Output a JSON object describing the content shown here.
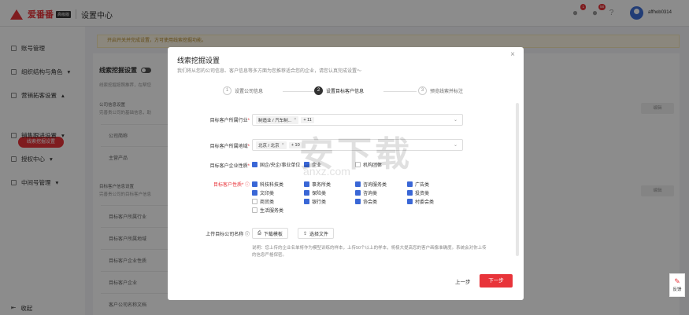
{
  "header": {
    "logo_text": "爱番番",
    "logo_badge": "高级版",
    "title": "设置中心",
    "badges": [
      "1",
      "58"
    ],
    "username": "affhob0314"
  },
  "sidebar": {
    "items": [
      {
        "label": "账号管理"
      },
      {
        "label": "组织结构与角色"
      },
      {
        "label": "营销拓客设置"
      },
      {
        "label": "销售跟进设置"
      },
      {
        "label": "授权中心"
      },
      {
        "label": "中间号管理"
      }
    ],
    "active_sub": "线索挖掘设置",
    "collapse_label": "收起"
  },
  "notice": "开启开关并完成设置，方可使用线索挖掘功能。",
  "content": {
    "title": "线索挖掘设置",
    "desc": "线索挖掘按照推荐，在帮您",
    "section1_title": "公司信息设置",
    "section1_desc": "完善贵公司的基础信息，助",
    "rows1": [
      "公司简称",
      "主营产品"
    ],
    "section2_title": "目标客户信息设置",
    "section2_desc": "完善贵公司的目标客户信息",
    "rows2": [
      "目标客户所属行业",
      "目标客户所属地域",
      "目标客户企业性质",
      "目标客户企业",
      "客户公司名称文档"
    ],
    "edit_label": "编辑"
  },
  "modal": {
    "title": "线索挖掘设置",
    "subtitle": "我们将从您的公司信息、客户信息等多方面为您推荐适合您的企业，请您认真完成设置～",
    "steps": [
      {
        "num": "1",
        "label": "设置公司信息"
      },
      {
        "num": "2",
        "label": "设置目标客户信息"
      },
      {
        "num": "3",
        "label": "预览线索并标注"
      }
    ],
    "industry_label": "目标客户所属行业",
    "industry_tags": [
      "制造业 / 汽车制...",
      "+ 11"
    ],
    "region_label": "目标客户所属地域",
    "region_tags": [
      "北京 / 北京",
      "+ 10"
    ],
    "nature_label": "目标客户企业性质",
    "nature_options": [
      {
        "label": "国企/央企/事业单位",
        "checked": true
      },
      {
        "label": "企业",
        "checked": true
      },
      {
        "label": "机构团体",
        "checked": false
      }
    ],
    "attr_label": "目标客户性质",
    "attr_options": [
      {
        "label": "科技科技类",
        "checked": true
      },
      {
        "label": "事务所类",
        "checked": true
      },
      {
        "label": "咨询服务类",
        "checked": true
      },
      {
        "label": "广告类",
        "checked": true
      },
      {
        "label": "文印类",
        "checked": true
      },
      {
        "label": "保险类",
        "checked": true
      },
      {
        "label": "咨询类",
        "checked": true
      },
      {
        "label": "投资类",
        "checked": true
      },
      {
        "label": "商贸类",
        "checked": false
      },
      {
        "label": "银行类",
        "checked": true
      },
      {
        "label": "协会类",
        "checked": true
      },
      {
        "label": "村委会类",
        "checked": true
      },
      {
        "label": "生活服务类",
        "checked": false
      }
    ],
    "upload_label": "上传目标公司名称",
    "download_btn": "下载模板",
    "select_file_btn": "选择文件",
    "note": "说明：您上传的企业名单将作为模型训练的样本，上传50个以上的样本，将极大提高您的客户画像准确度。系统会对你上传的信息严格保密。",
    "prev_btn": "上一步",
    "next_btn": "下一步"
  },
  "feedback_label": "反馈",
  "watermark": "安下载",
  "watermark_url": "anxz.com"
}
